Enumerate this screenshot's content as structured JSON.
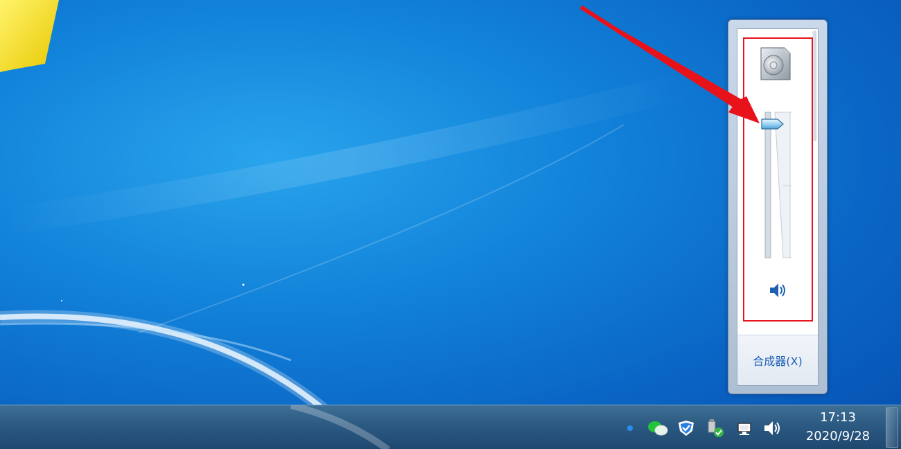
{
  "volume_flyout": {
    "mixer_label": "合成器(X)",
    "volume_level": 0.92,
    "device_icon": "speaker-device-icon",
    "mute_icon": "speaker-volume-icon"
  },
  "taskbar": {
    "tray_icons": [
      "notification-dot-icon",
      "wechat-icon",
      "security-shield-icon",
      "usb-safely-remove-icon",
      "network-icon",
      "speaker-volume-icon"
    ],
    "clock": {
      "time": "17:13",
      "date": "2020/9/28"
    }
  },
  "annotation": {
    "color": "#e8121b"
  }
}
